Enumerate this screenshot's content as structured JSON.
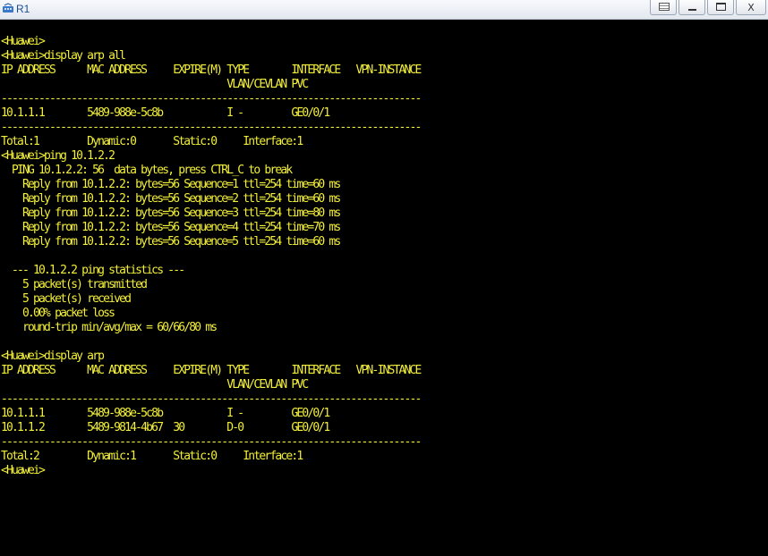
{
  "window": {
    "title": "R1",
    "controls": {
      "menu_icon": "menu-icon",
      "minimize_icon": "minimize-icon",
      "maximize_icon": "maximize-icon",
      "close_label": "X"
    }
  },
  "colors": {
    "terminal_bg": "#000000",
    "terminal_text": "#f2ee3c",
    "titlebar_text": "#1d4e94"
  },
  "terminal": {
    "lines": [
      "<Huawei>",
      "<Huawei>display arp all",
      "IP ADDRESS      MAC ADDRESS     EXPIRE(M) TYPE        INTERFACE   VPN-INSTANCE",
      "                                          VLAN/CEVLAN PVC",
      "------------------------------------------------------------------------------",
      "10.1.1.1        5489-988e-5c8b            I -         GE0/0/1",
      "------------------------------------------------------------------------------",
      "Total:1         Dynamic:0       Static:0     Interface:1",
      "<Huawei>ping 10.1.2.2",
      "  PING 10.1.2.2: 56  data bytes, press CTRL_C to break",
      "    Reply from 10.1.2.2: bytes=56 Sequence=1 ttl=254 time=60 ms",
      "    Reply from 10.1.2.2: bytes=56 Sequence=2 ttl=254 time=60 ms",
      "    Reply from 10.1.2.2: bytes=56 Sequence=3 ttl=254 time=80 ms",
      "    Reply from 10.1.2.2: bytes=56 Sequence=4 ttl=254 time=70 ms",
      "    Reply from 10.1.2.2: bytes=56 Sequence=5 ttl=254 time=60 ms",
      "",
      "  --- 10.1.2.2 ping statistics ---",
      "    5 packet(s) transmitted",
      "    5 packet(s) received",
      "    0.00% packet loss",
      "    round-trip min/avg/max = 60/66/80 ms",
      "",
      "<Huawei>display arp",
      "IP ADDRESS      MAC ADDRESS     EXPIRE(M) TYPE        INTERFACE   VPN-INSTANCE",
      "                                          VLAN/CEVLAN PVC",
      "------------------------------------------------------------------------------",
      "10.1.1.1        5489-988e-5c8b            I -         GE0/0/1",
      "10.1.1.2        5489-9814-4b67  30        D-0         GE0/0/1",
      "------------------------------------------------------------------------------",
      "Total:2         Dynamic:1       Static:0     Interface:1",
      "<Huawei>"
    ]
  }
}
